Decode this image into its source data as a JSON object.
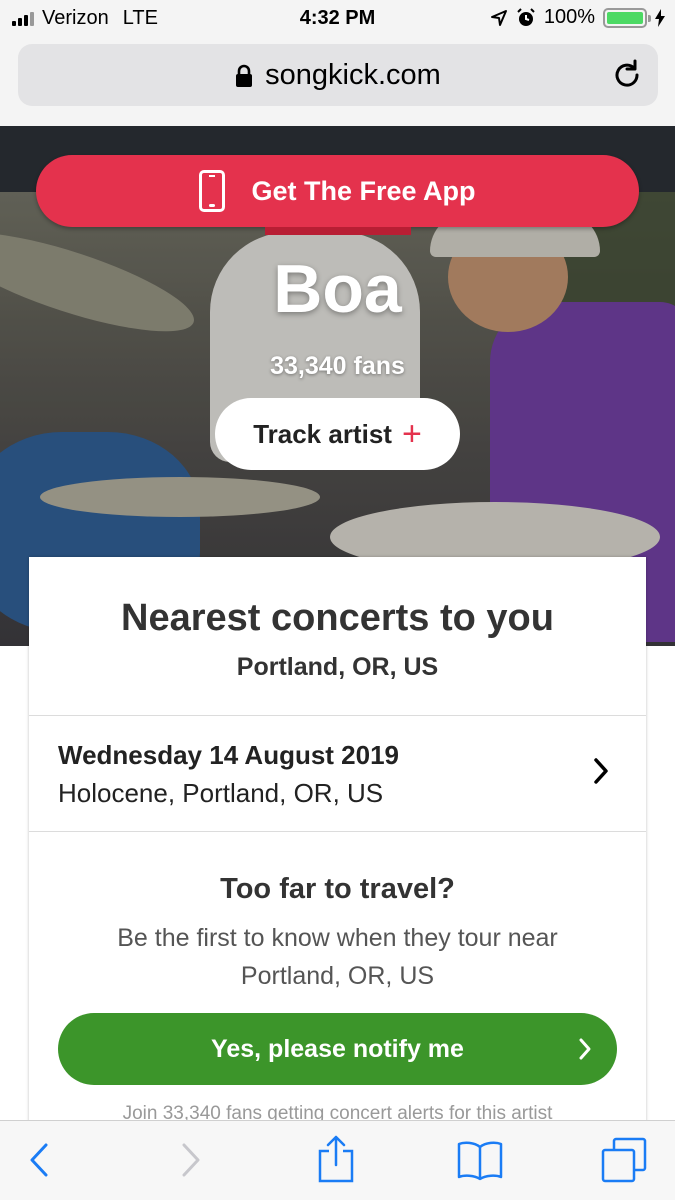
{
  "status_bar": {
    "carrier": "Verizon",
    "network": "LTE",
    "time": "4:32 PM",
    "battery": "100%",
    "battery_level": 1.0
  },
  "browser": {
    "url": "songkick.com"
  },
  "app_banner": {
    "label": "Get The Free App"
  },
  "artist": {
    "name": "Boa",
    "fans": "33,340 fans",
    "track_label": "Track artist"
  },
  "nearest": {
    "title": "Nearest concerts to you",
    "location": "Portland, OR, US",
    "concerts": [
      {
        "date": "Wednesday 14 August 2019",
        "venue": "Holocene, Portland, OR, US"
      }
    ]
  },
  "too_far": {
    "title": "Too far to travel?",
    "text": "Be the first to know when they tour near Portland, OR, US",
    "button": "Yes, please notify me",
    "footer": "Join 33,340 fans getting concert alerts for this artist"
  },
  "colors": {
    "brand_red": "#e4324d",
    "notify_green": "#3c952a",
    "ios_blue": "#1a7cf5",
    "header_dark": "#24282d"
  }
}
